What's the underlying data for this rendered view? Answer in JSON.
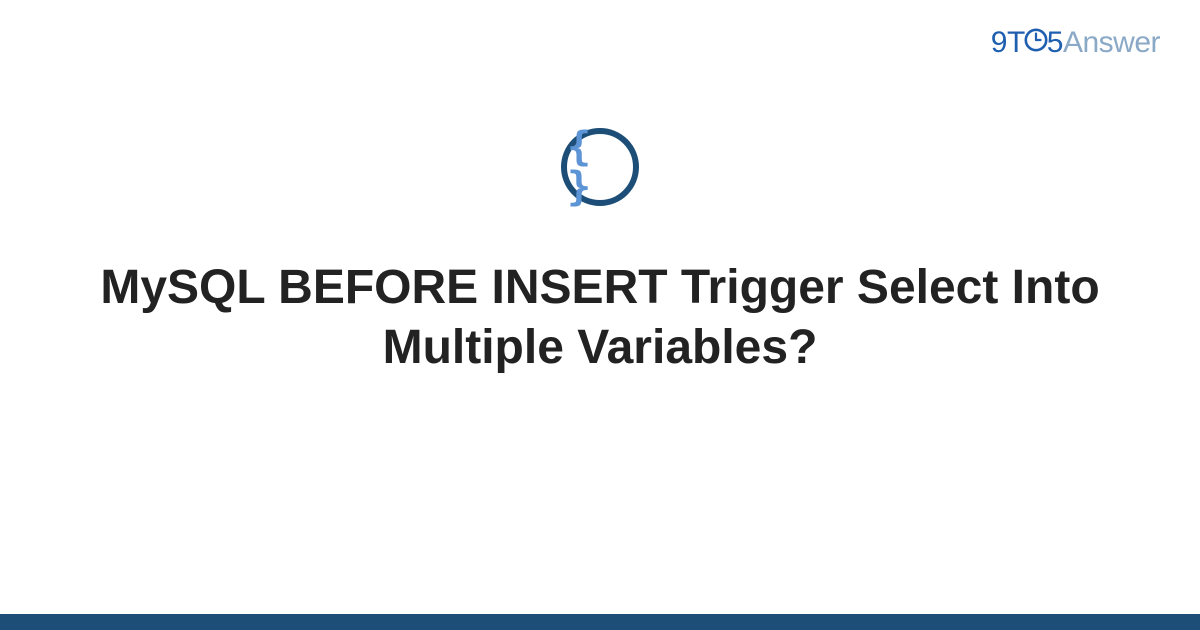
{
  "brand": {
    "part_9": "9",
    "part_t": "T",
    "part_5": "5",
    "part_answer": "Answer"
  },
  "badge": {
    "glyph": "{ }",
    "icon_name": "code-braces-icon"
  },
  "heading": {
    "text": "MySQL BEFORE INSERT Trigger Select Into Multiple Variables?"
  },
  "colors": {
    "brand_primary": "#1f5fb0",
    "brand_soft": "#8aa9c7",
    "badge_ring": "#1d4e77",
    "badge_glyph": "#5c94d6",
    "footer": "#1d4e77",
    "text": "#222222"
  }
}
